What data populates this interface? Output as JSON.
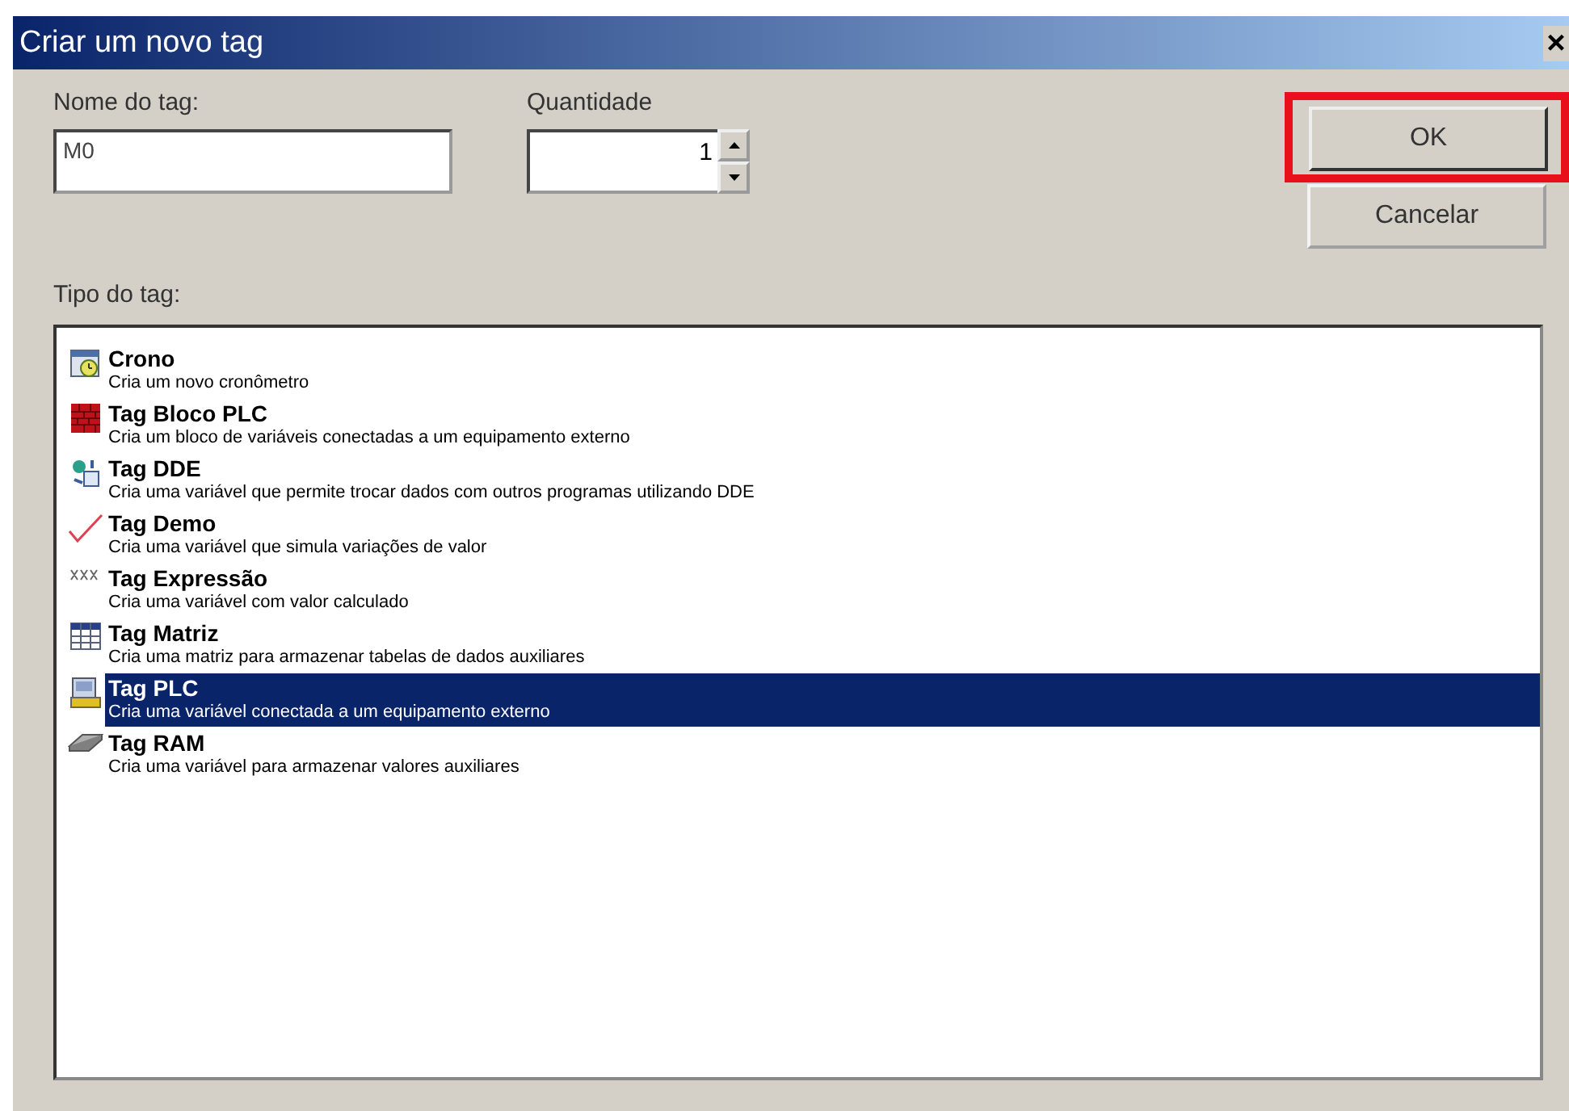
{
  "window": {
    "title": "Criar um novo tag",
    "close": "×"
  },
  "name_field": {
    "label": "Nome do tag:",
    "value": "M0"
  },
  "quantity_field": {
    "label": "Quantidade",
    "value": "1"
  },
  "buttons": [
    {
      "label": "OK",
      "highlighted": true
    },
    {
      "label": "Cancelar",
      "highlighted": false
    }
  ],
  "type_list": {
    "label": "Tipo do tag:",
    "items": [
      {
        "kind": "crono",
        "name": "Crono",
        "description": "Cria um novo cronômetro",
        "selected": false
      },
      {
        "kind": "block",
        "name": "Tag Bloco PLC",
        "description": "Cria um bloco de variáveis conectadas a um equipamento externo",
        "selected": false
      },
      {
        "kind": "dde",
        "name": "Tag DDE",
        "description": "Cria uma variável que permite trocar dados com outros programas utilizando DDE",
        "selected": false
      },
      {
        "kind": "demo",
        "name": "Tag Demo",
        "description": "Cria uma variável que simula variações de valor",
        "selected": false
      },
      {
        "kind": "expression",
        "name": "Tag Expressão",
        "description": "Cria uma variável com valor calculado",
        "selected": false
      },
      {
        "kind": "matrix",
        "name": "Tag Matriz",
        "description": "Cria uma matriz para armazenar tabelas de dados auxiliares",
        "selected": false
      },
      {
        "kind": "plc",
        "name": "Tag PLC",
        "description": "Cria uma variável conectada a um equipamento externo",
        "selected": true
      },
      {
        "kind": "ram",
        "name": "Tag RAM",
        "description": "Cria uma variável para armazenar valores auxiliares",
        "selected": false
      }
    ]
  }
}
